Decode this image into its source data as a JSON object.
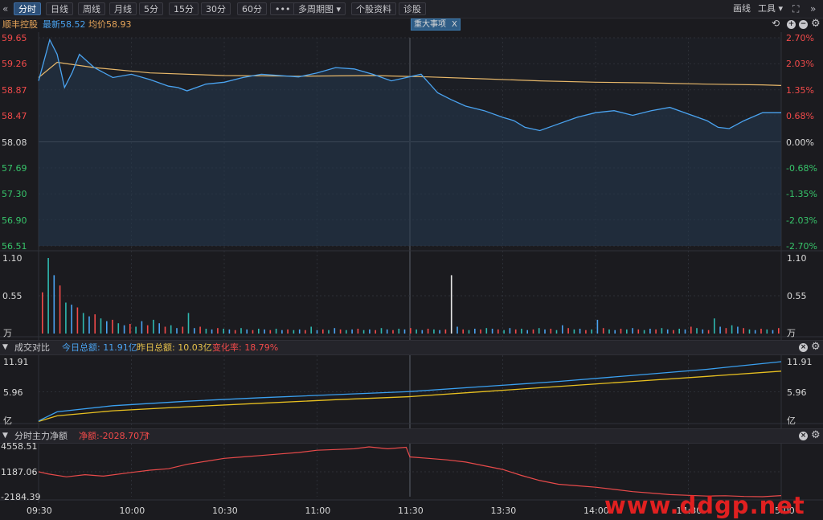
{
  "toolbar": {
    "back_icon": "«",
    "tabs": [
      {
        "label": "分时",
        "active": true
      },
      {
        "label": "日线"
      },
      {
        "label": "周线"
      },
      {
        "label": "月线"
      },
      {
        "label": "5分"
      },
      {
        "label": "15分"
      },
      {
        "label": "30分"
      },
      {
        "label": "60分"
      },
      {
        "label": "•••"
      },
      {
        "label": "多周期图 ▾"
      },
      {
        "label": "个股资料"
      },
      {
        "label": "诊股"
      }
    ],
    "draw_label": "画线",
    "tools_label": "工具 ▾",
    "fullscreen_icon": "⛶",
    "forward_icon": "»"
  },
  "info": {
    "stock_name": "顺丰控股",
    "latest": "最新58.52",
    "avg": "均价58.93",
    "event_label": "重大事项",
    "event_close": "X"
  },
  "price_axis": {
    "left": [
      "59.65",
      "59.26",
      "58.87",
      "58.47",
      "58.08",
      "57.69",
      "57.30",
      "56.90",
      "56.51"
    ],
    "right": [
      "2.70%",
      "2.03%",
      "1.35%",
      "0.68%",
      "0.00%",
      "-0.68%",
      "-1.35%",
      "-2.03%",
      "-2.70%"
    ],
    "base_price": 58.08
  },
  "volume_axis": {
    "left": [
      "1.10",
      "0.55",
      "万"
    ],
    "right": [
      "1.10",
      "0.55",
      "万"
    ]
  },
  "turnover_panel": {
    "title": "成交对比",
    "today": "今日总额: 11.91亿",
    "yesterday": "昨日总额: 10.03亿",
    "change": "变化率: 18.79%",
    "axis_left": [
      "11.91",
      "5.96",
      "亿"
    ],
    "axis_right": [
      "11.91",
      "5.96",
      "亿"
    ]
  },
  "flow_panel": {
    "title": "分时主力净额",
    "net": "净额:-2028.70万",
    "net_arrow": "↑",
    "axis_left": [
      "4558.51",
      "1187.06",
      "-2184.39"
    ]
  },
  "time_axis": [
    "09:30",
    "10:00",
    "10:30",
    "11:00",
    "11:30",
    "13:30",
    "14:00",
    "14:30",
    "15:00"
  ],
  "watermark": "www.ddgp.net",
  "colors": {
    "price_line": "#4aa3f0",
    "avg_line": "#e8b86a",
    "up": "#f24a4a",
    "down": "#37c46a",
    "today_turnover": "#3aa0f0",
    "yesterday_turnover": "#e8c020",
    "flow_line": "#e84a4a"
  },
  "chart_data": [
    {
      "type": "line",
      "title": "",
      "xlabel": "",
      "ylabel": "",
      "ylim": [
        56.51,
        59.65
      ],
      "series": [
        {
          "name": "最新",
          "points": [
            [
              0,
              59.0
            ],
            [
              6,
              59.62
            ],
            [
              10,
              59.4
            ],
            [
              14,
              58.9
            ],
            [
              18,
              59.12
            ],
            [
              22,
              59.4
            ],
            [
              30,
              59.2
            ],
            [
              40,
              59.05
            ],
            [
              50,
              59.1
            ],
            [
              60,
              59.02
            ],
            [
              70,
              58.92
            ],
            [
              75,
              58.9
            ],
            [
              80,
              58.85
            ],
            [
              90,
              58.95
            ],
            [
              100,
              58.98
            ],
            [
              110,
              59.05
            ],
            [
              120,
              59.1
            ],
            [
              130,
              59.08
            ],
            [
              140,
              59.06
            ],
            [
              150,
              59.12
            ],
            [
              160,
              59.2
            ],
            [
              170,
              59.18
            ],
            [
              180,
              59.1
            ],
            [
              190,
              59.0
            ],
            [
              198,
              59.05
            ],
            [
              206,
              59.1
            ],
            [
              215,
              58.82
            ],
            [
              222,
              58.72
            ],
            [
              230,
              58.62
            ],
            [
              240,
              58.55
            ],
            [
              250,
              58.45
            ],
            [
              256,
              58.4
            ],
            [
              262,
              58.3
            ],
            [
              270,
              58.25
            ],
            [
              280,
              58.35
            ],
            [
              290,
              58.45
            ],
            [
              300,
              58.52
            ],
            [
              310,
              58.55
            ],
            [
              320,
              58.48
            ],
            [
              330,
              58.55
            ],
            [
              340,
              58.6
            ],
            [
              350,
              58.5
            ],
            [
              360,
              58.4
            ],
            [
              366,
              58.3
            ],
            [
              372,
              58.28
            ],
            [
              380,
              58.4
            ],
            [
              390,
              58.52
            ],
            [
              400,
              58.52
            ]
          ]
        },
        {
          "name": "均价",
          "points": [
            [
              0,
              59.05
            ],
            [
              10,
              59.28
            ],
            [
              30,
              59.2
            ],
            [
              60,
              59.12
            ],
            [
              100,
              59.08
            ],
            [
              140,
              59.07
            ],
            [
              180,
              59.08
            ],
            [
              210,
              59.06
            ],
            [
              240,
              59.03
            ],
            [
              270,
              59.0
            ],
            [
              300,
              58.98
            ],
            [
              330,
              58.97
            ],
            [
              360,
              58.95
            ],
            [
              390,
              58.94
            ],
            [
              400,
              58.93
            ]
          ]
        }
      ]
    },
    {
      "type": "bar",
      "title": "",
      "ylim": [
        0,
        1.1
      ],
      "series": [
        {
          "name": "",
          "values": [
            0.6,
            1.1,
            0.85,
            0.7,
            0.45,
            0.42,
            0.38,
            0.3,
            0.25,
            0.28,
            0.22,
            0.18,
            0.2,
            0.15,
            0.12,
            0.14,
            0.1,
            0.18,
            0.12,
            0.2,
            0.15,
            0.1,
            0.12,
            0.08,
            0.1,
            0.3,
            0.08,
            0.1,
            0.07,
            0.06,
            0.08,
            0.07,
            0.06,
            0.05,
            0.08,
            0.06,
            0.05,
            0.07,
            0.06,
            0.05,
            0.07,
            0.05,
            0.06,
            0.05,
            0.06,
            0.05,
            0.1,
            0.05,
            0.06,
            0.05,
            0.08,
            0.06,
            0.05,
            0.06,
            0.07,
            0.05,
            0.06,
            0.05,
            0.08,
            0.06,
            0.05,
            0.07,
            0.06,
            0.08,
            0.06,
            0.05,
            0.07,
            0.06,
            0.05,
            0.06,
            0.85,
            0.1,
            0.06,
            0.05,
            0.07,
            0.06,
            0.08,
            0.07,
            0.06,
            0.05,
            0.08,
            0.06,
            0.07,
            0.05,
            0.06,
            0.08,
            0.06,
            0.07,
            0.05,
            0.12,
            0.08,
            0.06,
            0.07,
            0.05,
            0.06,
            0.2,
            0.08,
            0.06,
            0.05,
            0.07,
            0.06,
            0.08,
            0.06,
            0.05,
            0.07,
            0.06,
            0.08,
            0.06,
            0.05,
            0.07,
            0.06,
            0.1,
            0.08,
            0.06,
            0.05,
            0.22,
            0.1,
            0.08,
            0.12,
            0.1,
            0.08,
            0.06,
            0.05,
            0.07,
            0.06,
            0.05,
            0.08
          ]
        }
      ]
    },
    {
      "type": "line",
      "title": "成交对比",
      "ylim": [
        0,
        11.91
      ],
      "series": [
        {
          "name": "今日总额",
          "points": [
            [
              0,
              0.2
            ],
            [
              10,
              2.0
            ],
            [
              40,
              3.2
            ],
            [
              80,
              4.1
            ],
            [
              120,
              4.8
            ],
            [
              160,
              5.4
            ],
            [
              200,
              6.0
            ],
            [
              240,
              7.0
            ],
            [
              280,
              8.0
            ],
            [
              320,
              9.2
            ],
            [
              360,
              10.4
            ],
            [
              400,
              11.91
            ]
          ]
        },
        {
          "name": "昨日总额",
          "points": [
            [
              0,
              0.1
            ],
            [
              10,
              1.2
            ],
            [
              40,
              2.2
            ],
            [
              80,
              3.0
            ],
            [
              120,
              3.7
            ],
            [
              160,
              4.4
            ],
            [
              200,
              5.0
            ],
            [
              240,
              6.0
            ],
            [
              280,
              7.0
            ],
            [
              320,
              8.0
            ],
            [
              360,
              9.0
            ],
            [
              400,
              10.03
            ]
          ]
        }
      ]
    },
    {
      "type": "line",
      "title": "分时主力净额",
      "ylim": [
        -2184.39,
        4558.51
      ],
      "series": [
        {
          "name": "",
          "points": [
            [
              0,
              1200
            ],
            [
              5,
              900
            ],
            [
              15,
              500
            ],
            [
              25,
              800
            ],
            [
              35,
              600
            ],
            [
              50,
              1100
            ],
            [
              60,
              1400
            ],
            [
              70,
              1600
            ],
            [
              80,
              2200
            ],
            [
              90,
              2600
            ],
            [
              100,
              3000
            ],
            [
              110,
              3200
            ],
            [
              120,
              3400
            ],
            [
              130,
              3600
            ],
            [
              140,
              3800
            ],
            [
              150,
              4100
            ],
            [
              160,
              4200
            ],
            [
              170,
              4300
            ],
            [
              178,
              4558
            ],
            [
              188,
              4300
            ],
            [
              198,
              4500
            ],
            [
              200,
              3200
            ],
            [
              210,
              3000
            ],
            [
              220,
              2800
            ],
            [
              230,
              2500
            ],
            [
              240,
              2000
            ],
            [
              250,
              1500
            ],
            [
              260,
              700
            ],
            [
              270,
              0
            ],
            [
              280,
              -500
            ],
            [
              290,
              -700
            ],
            [
              300,
              -900
            ],
            [
              310,
              -1200
            ],
            [
              320,
              -1500
            ],
            [
              330,
              -1700
            ],
            [
              340,
              -1900
            ],
            [
              350,
              -2000
            ],
            [
              360,
              -2100
            ],
            [
              370,
              -2050
            ],
            [
              380,
              -2150
            ],
            [
              390,
              -2184
            ],
            [
              400,
              -2028
            ]
          ]
        }
      ]
    }
  ]
}
